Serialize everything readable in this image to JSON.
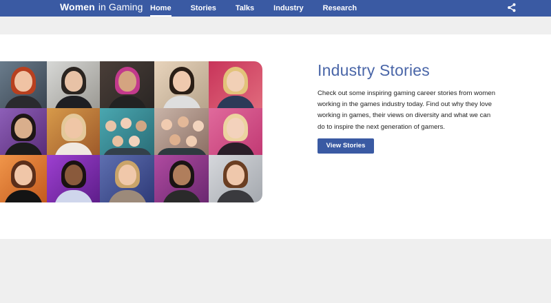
{
  "nav": {
    "brand_bold": "Women",
    "brand_rest": "in Gaming",
    "links": [
      "Home",
      "Stories",
      "Talks",
      "Industry",
      "Research"
    ],
    "active": "Home",
    "share_icon": "share-icon"
  },
  "feature": {
    "title": "Industry Stories",
    "description": "Check out some inspiring gaming career stories from women working in the games industry today. Find out why they love working in games, their views on diversity and what we can do to inspire the next generation of gamers.",
    "button": "View Stories"
  },
  "colors": {
    "nav_bg": "#3a5aa3",
    "accent": "#4a66a8",
    "page_bg": "#efefef",
    "panel_bg": "#ffffff"
  }
}
